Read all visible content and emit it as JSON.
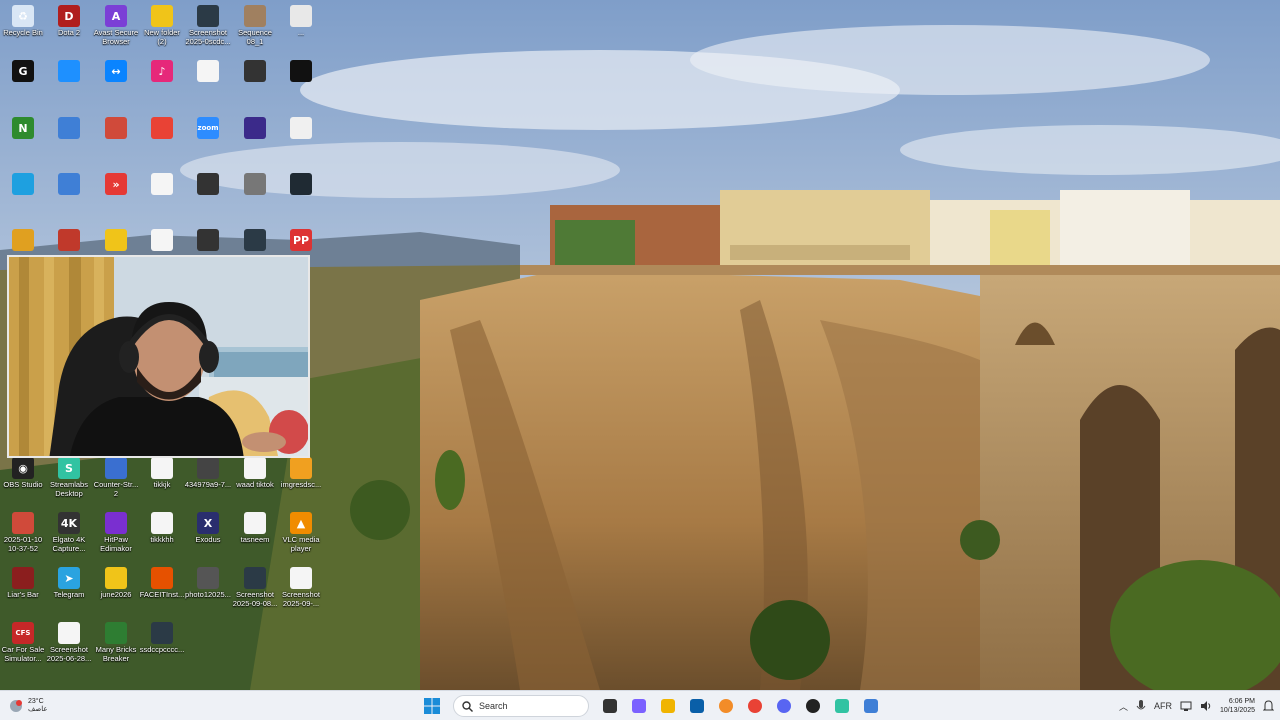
{
  "desktop_icons": [
    {
      "label": "Recycle Bin",
      "color": "#d9e6f5",
      "glyph": "♻",
      "icon": "recycle-bin-icon"
    },
    {
      "label": "Dota 2",
      "color": "#b01e1e",
      "glyph": "D",
      "icon": "dota-icon"
    },
    {
      "label": "Avast Secure\nBrowser",
      "color": "#7b3fd6",
      "glyph": "A",
      "icon": "avast-icon"
    },
    {
      "label": "New folder\n(2)",
      "color": "#f0c419",
      "glyph": "",
      "icon": "folder-icon"
    },
    {
      "label": "Screenshot\n2025-0scdc...",
      "color": "#2b3a46",
      "glyph": "",
      "icon": "screenshot-icon"
    },
    {
      "label": "Sequence\n08_1",
      "color": "#a08060",
      "glyph": "",
      "icon": "video-file-icon"
    },
    {
      "label": "...",
      "color": "#e8e8e8",
      "glyph": "",
      "icon": "file-icon"
    },
    {
      "label": "",
      "color": "#111",
      "glyph": "G",
      "icon": "ghub-icon"
    },
    {
      "label": "",
      "color": "#1e90ff",
      "glyph": "",
      "icon": "edge-icon"
    },
    {
      "label": "",
      "color": "#0a84ff",
      "glyph": "↔",
      "icon": "teamviewer-icon"
    },
    {
      "label": "",
      "color": "#e6287a",
      "glyph": "♪",
      "icon": "tiktok-icon"
    },
    {
      "label": "",
      "color": "#f5f5f5",
      "glyph": "",
      "icon": "document-icon"
    },
    {
      "label": "",
      "color": "#333",
      "glyph": "",
      "icon": "image-icon"
    },
    {
      "label": "",
      "color": "#111",
      "glyph": "",
      "icon": "file-icon"
    },
    {
      "label": "",
      "color": "#2e8b2e",
      "glyph": "N",
      "icon": "nvidia-icon"
    },
    {
      "label": "",
      "color": "#3f7fd6",
      "glyph": "",
      "icon": "app-icon"
    },
    {
      "label": "",
      "color": "#d04a3a",
      "glyph": "",
      "icon": "winrar-icon"
    },
    {
      "label": "",
      "color": "#e94235",
      "glyph": "",
      "icon": "chrome-icon"
    },
    {
      "label": "",
      "color": "#2d8cff",
      "glyph": "zoom",
      "icon": "zoom-icon"
    },
    {
      "label": "",
      "color": "#3b2a8a",
      "glyph": "",
      "icon": "obs-icon"
    },
    {
      "label": "",
      "color": "#f0f0f0",
      "glyph": "",
      "icon": "file-icon"
    },
    {
      "label": "",
      "color": "#1ea0e0",
      "glyph": "",
      "icon": "this-pc-icon"
    },
    {
      "label": "",
      "color": "#3f7fd6",
      "glyph": "",
      "icon": "app-icon"
    },
    {
      "label": "",
      "color": "#e53935",
      "glyph": "»",
      "icon": "anydesk-icon"
    },
    {
      "label": "",
      "color": "#f5f5f5",
      "glyph": "",
      "icon": "document-icon"
    },
    {
      "label": "",
      "color": "#333",
      "glyph": "",
      "icon": "phone-icon"
    },
    {
      "label": "",
      "color": "#777",
      "glyph": "",
      "icon": "image-icon"
    },
    {
      "label": "",
      "color": "#1f2a33",
      "glyph": "",
      "icon": "file-icon"
    },
    {
      "label": "",
      "color": "#e0a020",
      "glyph": "",
      "icon": "winrar-icon"
    },
    {
      "label": "",
      "color": "#c0392b",
      "glyph": "",
      "icon": "faceit-icon"
    },
    {
      "label": "",
      "color": "#f0c419",
      "glyph": "",
      "icon": "folder-icon"
    },
    {
      "label": "",
      "color": "#f5f5f5",
      "glyph": "",
      "icon": "document-icon"
    },
    {
      "label": "",
      "color": "#333",
      "glyph": "",
      "icon": "phone-icon"
    },
    {
      "label": "",
      "color": "#2b3a46",
      "glyph": "",
      "icon": "screenshot-icon"
    },
    {
      "label": "",
      "color": "#d33",
      "glyph": "PP",
      "icon": "app-icon"
    },
    {
      "label": "OBS Studio",
      "color": "#222",
      "glyph": "◉",
      "icon": "obs-icon"
    },
    {
      "label": "Streamlabs\nDesktop",
      "color": "#31c3a2",
      "glyph": "S",
      "icon": "streamlabs-icon"
    },
    {
      "label": "Counter-Str...\n2",
      "color": "#3a6fd0",
      "glyph": "",
      "icon": "cs2-icon"
    },
    {
      "label": "tikkjk",
      "color": "#f5f5f5",
      "glyph": "",
      "icon": "document-icon"
    },
    {
      "label": "434979a9-7...",
      "color": "#444",
      "glyph": "",
      "icon": "phone-icon"
    },
    {
      "label": "waad tiktok",
      "color": "#f5f5f5",
      "glyph": "",
      "icon": "document-icon"
    },
    {
      "label": "imgresdsc...",
      "color": "#f0a020",
      "glyph": "",
      "icon": "image-icon"
    },
    {
      "label": "2025-01-10\n10-37-52",
      "color": "#d04a3a",
      "glyph": "",
      "icon": "winrar-icon"
    },
    {
      "label": "Elgato 4K\nCapture...",
      "color": "#333",
      "glyph": "4K",
      "icon": "elgato-icon"
    },
    {
      "label": "HitPaw\nEdimakor",
      "color": "#7a2fd0",
      "glyph": "",
      "icon": "hitpaw-icon"
    },
    {
      "label": "tikkkhh",
      "color": "#f5f5f5",
      "glyph": "",
      "icon": "document-icon"
    },
    {
      "label": "Exodus",
      "color": "#2a2e6e",
      "glyph": "X",
      "icon": "exodus-icon"
    },
    {
      "label": "tasneem",
      "color": "#f5f5f5",
      "glyph": "",
      "icon": "document-icon"
    },
    {
      "label": "VLC media\nplayer",
      "color": "#f08c00",
      "glyph": "▲",
      "icon": "vlc-icon"
    },
    {
      "label": "Liar's Bar",
      "color": "#8b1e1e",
      "glyph": "",
      "icon": "game-icon"
    },
    {
      "label": "Telegram",
      "color": "#2aa3e0",
      "glyph": "➤",
      "icon": "telegram-icon"
    },
    {
      "label": "june2026",
      "color": "#f0c419",
      "glyph": "",
      "icon": "folder-icon"
    },
    {
      "label": "FACEITInst...",
      "color": "#e65100",
      "glyph": "",
      "icon": "faceit-icon"
    },
    {
      "label": "photo12025...",
      "color": "#555",
      "glyph": "",
      "icon": "image-icon"
    },
    {
      "label": "Screenshot\n2025-09-08...",
      "color": "#2b3a46",
      "glyph": "",
      "icon": "screenshot-icon"
    },
    {
      "label": "Screenshot\n2025-09-...",
      "color": "#f5f5f5",
      "glyph": "",
      "icon": "document-icon"
    },
    {
      "label": "Car For Sale\nSimulator...",
      "color": "#c62828",
      "glyph": "CFS",
      "icon": "game-icon"
    },
    {
      "label": "Screenshot\n2025-06-28...",
      "color": "#f5f5f5",
      "glyph": "",
      "icon": "document-icon"
    },
    {
      "label": "Many Bricks\nBreaker",
      "color": "#2e7d32",
      "glyph": "",
      "icon": "game-icon"
    },
    {
      "label": "ssdccpcccc...",
      "color": "#2b3a46",
      "glyph": "",
      "icon": "image-icon"
    }
  ],
  "taskbar": {
    "weather_temp": "23°C",
    "weather_desc": "عاصف",
    "search_placeholder": "Search",
    "tray_lang": "AFR",
    "clock_time": "6:06 PM",
    "clock_date": "10/13/2025",
    "apps": [
      {
        "icon": "task-view-icon",
        "color": "#333"
      },
      {
        "icon": "copilot-icon",
        "color": "#7b61ff"
      },
      {
        "icon": "file-explorer-icon",
        "color": "#f0b400"
      },
      {
        "icon": "store-icon",
        "color": "#0a5fa8"
      },
      {
        "icon": "avast-browser-icon",
        "color": "#f28c28"
      },
      {
        "icon": "chrome-icon",
        "color": "#e94235"
      },
      {
        "icon": "discord-icon",
        "color": "#5865f2"
      },
      {
        "icon": "github-icon",
        "color": "#222"
      },
      {
        "icon": "streamlabs-icon",
        "color": "#31c3a2"
      },
      {
        "icon": "notepad-icon",
        "color": "#3f7fd6"
      }
    ]
  }
}
